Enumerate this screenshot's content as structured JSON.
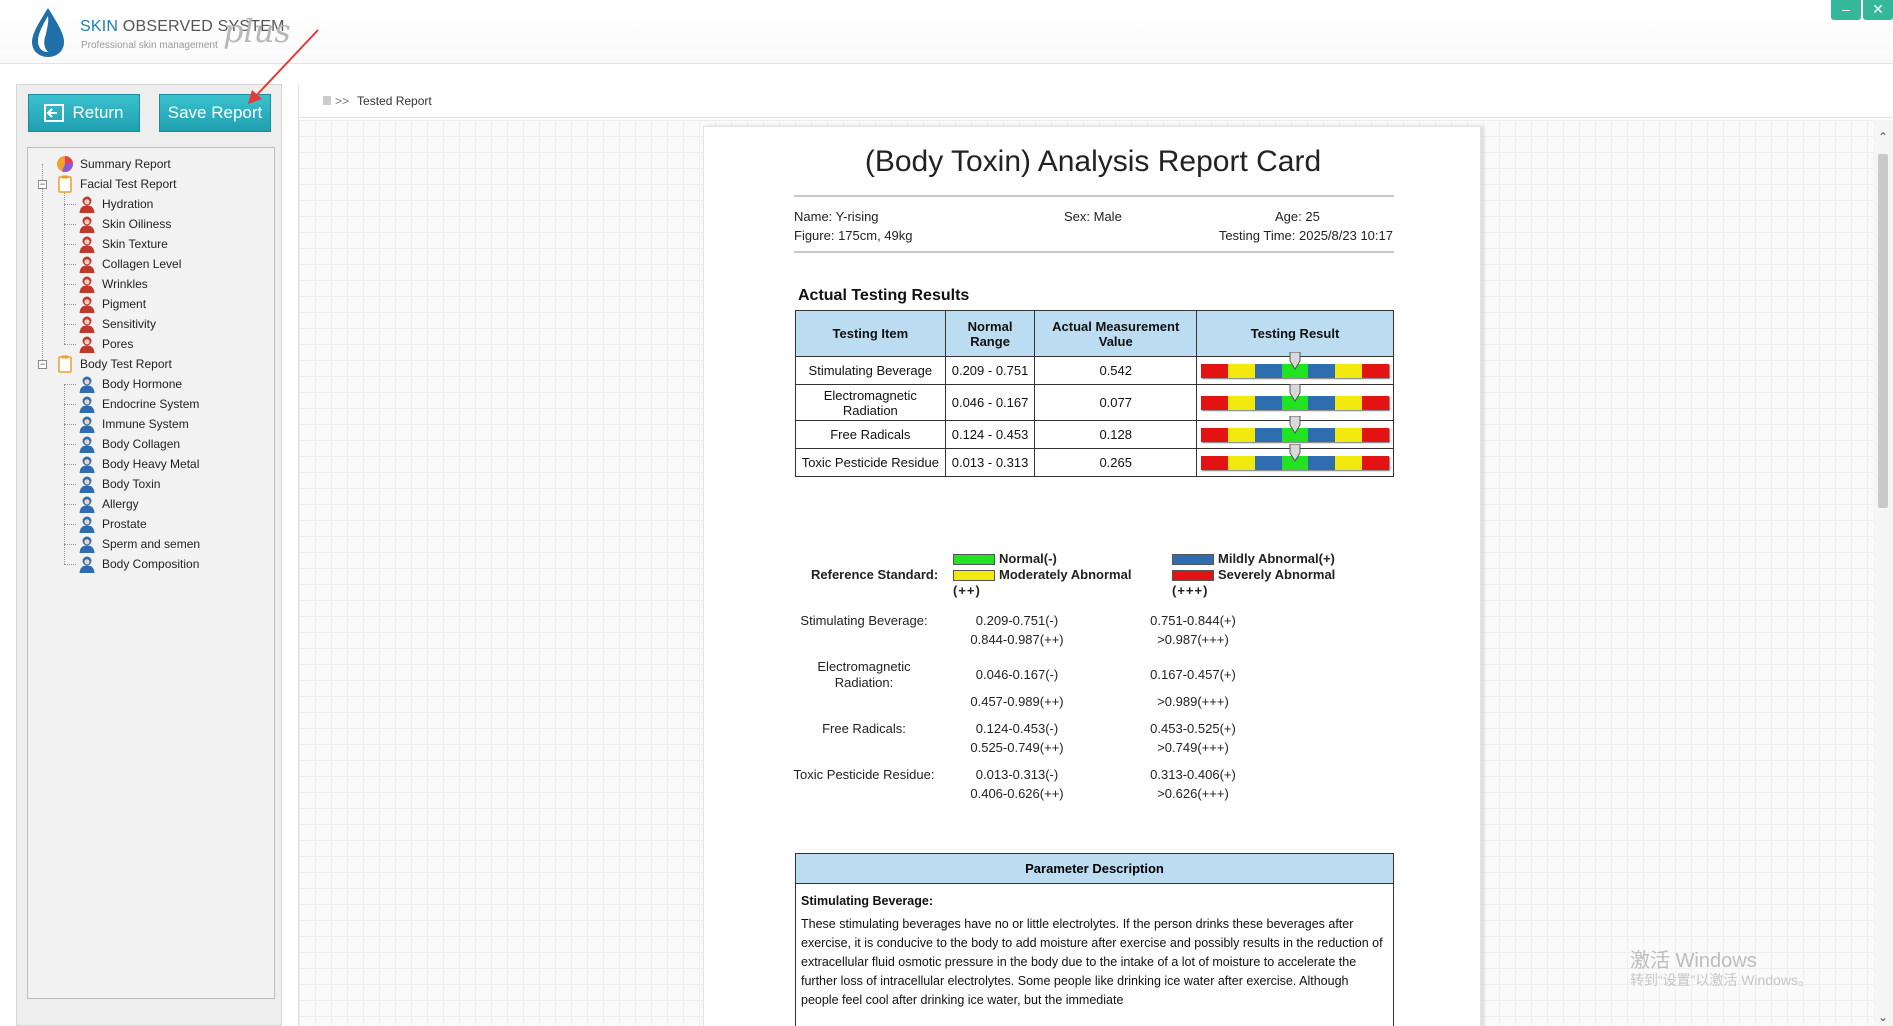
{
  "app": {
    "logo_brand": "SKIN",
    "logo_title_rest": " OBSERVED SYSTEM",
    "logo_subtitle": "Professional skin management",
    "logo_plus": "plus",
    "minimize": "–",
    "close": "✕"
  },
  "toolbar": {
    "return_label": "Return",
    "save_label": "Save Report"
  },
  "tree": {
    "summary": "Summary Report",
    "facial": "Facial Test Report",
    "facial_items": [
      "Hydration",
      "Skin Oiliness",
      "Skin Texture",
      "Collagen Level",
      "Wrinkles",
      "Pigment",
      "Sensitivity",
      "Pores"
    ],
    "body": "Body Test Report",
    "body_items": [
      "Body Hormone",
      "Endocrine System",
      "Immune System",
      "Body Collagen",
      "Body Heavy Metal",
      "Body Toxin",
      "Allergy",
      "Prostate",
      "Sperm and semen",
      "Body Composition"
    ]
  },
  "breadcrumb": {
    "arrows": ">>",
    "label": "Tested Report"
  },
  "report": {
    "title": "(Body Toxin) Analysis Report Card",
    "name": "Name: Y-rising",
    "sex": "Sex: Male",
    "age": "Age: 25",
    "figure": "Figure: 175cm, 49kg",
    "testing_time": "Testing Time: 2025/8/23 10:17",
    "section_title": "Actual Testing Results",
    "headers": {
      "item": "Testing Item",
      "range": "Normal Range",
      "value": "Actual Measurement Value",
      "result": "Testing Result"
    },
    "rows": [
      {
        "item": "Stimulating Beverage",
        "range": "0.209 - 0.751",
        "value": "0.542",
        "gauge_pos": 0.5
      },
      {
        "item": "Electromagnetic Radiation",
        "range": "0.046 - 0.167",
        "value": "0.077",
        "gauge_pos": 0.5
      },
      {
        "item": "Free Radicals",
        "range": "0.124 - 0.453",
        "value": "0.128",
        "gauge_pos": 0.5
      },
      {
        "item": "Toxic Pesticide Residue",
        "range": "0.013 - 0.313",
        "value": "0.265",
        "gauge_pos": 0.5
      }
    ],
    "gauge_colors": [
      "#e41313",
      "#f2ea0e",
      "#2f6db1",
      "#22e322",
      "#2f6db1",
      "#f2ea0e",
      "#e41313"
    ],
    "reference": {
      "label": "Reference Standard:",
      "normal": "Normal(-)",
      "mild": "Mildly Abnormal(+)",
      "moderate": "Moderately Abnormal",
      "moderate_suffix": "(++)",
      "severe": "Severely Abnormal",
      "severe_suffix": "(+++)",
      "colors": {
        "normal": "#22e322",
        "mild": "#2f6db1",
        "moderate": "#f2ea0e",
        "severe": "#e41313"
      }
    },
    "ref_items": [
      {
        "name": "Stimulating Beverage:",
        "normal": "0.209-0.751(-)",
        "mild": "0.751-0.844(+)",
        "moderate": "0.844-0.987(++)",
        "severe": ">0.987(+++)"
      },
      {
        "name": "Electromagnetic Radiation:",
        "normal": "0.046-0.167(-)",
        "mild": "0.167-0.457(+)",
        "moderate": "0.457-0.989(++)",
        "severe": ">0.989(+++)"
      },
      {
        "name": "Free Radicals:",
        "normal": "0.124-0.453(-)",
        "mild": "0.453-0.525(+)",
        "moderate": "0.525-0.749(++)",
        "severe": ">0.749(+++)"
      },
      {
        "name": "Toxic Pesticide Residue:",
        "normal": "0.013-0.313(-)",
        "mild": "0.313-0.406(+)",
        "moderate": "0.406-0.626(++)",
        "severe": ">0.626(+++)"
      }
    ],
    "param": {
      "header": "Parameter Description",
      "subtitle": "Stimulating Beverage:",
      "text": "These stimulating beverages have no or little electrolytes. If the person drinks these beverages after exercise, it is conducive to the body to add moisture after exercise and possibly results in the reduction of extracellular fluid osmotic pressure in the body due to the intake of a lot of moisture to accelerate the further loss of intracellular electrolytes. Some people like drinking ice water after exercise. Although people feel cool after drinking ice water, but the immediate"
    }
  },
  "watermark": {
    "line1": "激活 Windows",
    "line2": "转到“设置”以激活 Windows。"
  }
}
